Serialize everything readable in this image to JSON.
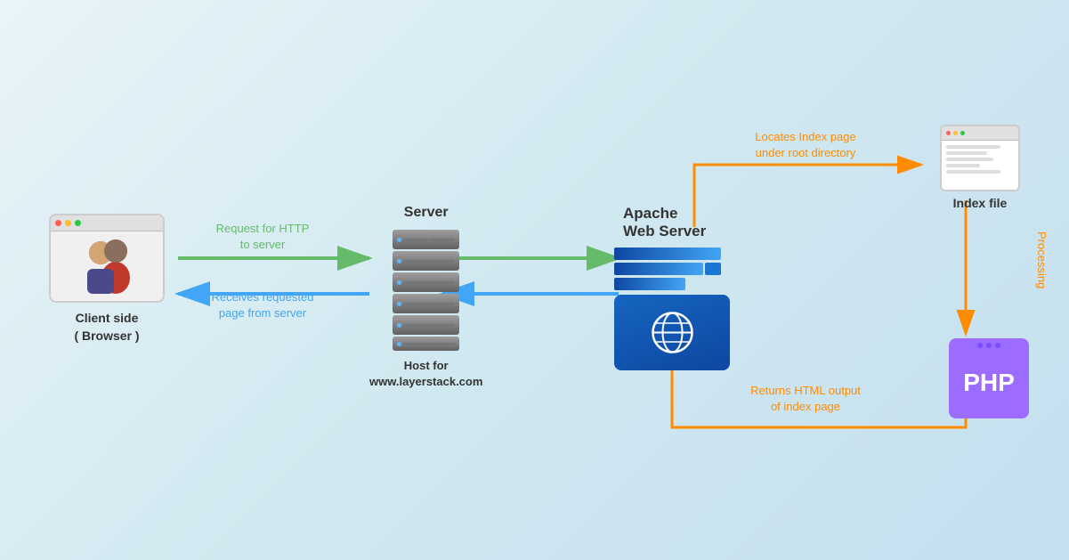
{
  "client": {
    "label_line1": "Client side",
    "label_line2": "( Browser )"
  },
  "server": {
    "top_label": "Server",
    "bottom_label_line1": "Host for",
    "bottom_label_line2": "www.layerstack.com"
  },
  "apache": {
    "label_line1": "Apache",
    "label_line2": "Web Server"
  },
  "index_file": {
    "label": "Index file"
  },
  "php": {
    "label": "PHP"
  },
  "arrows": {
    "green_top": "Request for HTTP\nto server",
    "blue_bottom": "Receives requested\npage from server",
    "orange_top_line1": "Locates Index page",
    "orange_top_line2": "under root directory",
    "orange_bottom_line1": "Returns HTML output",
    "orange_bottom_line2": "of index page",
    "processing": "Processing"
  }
}
